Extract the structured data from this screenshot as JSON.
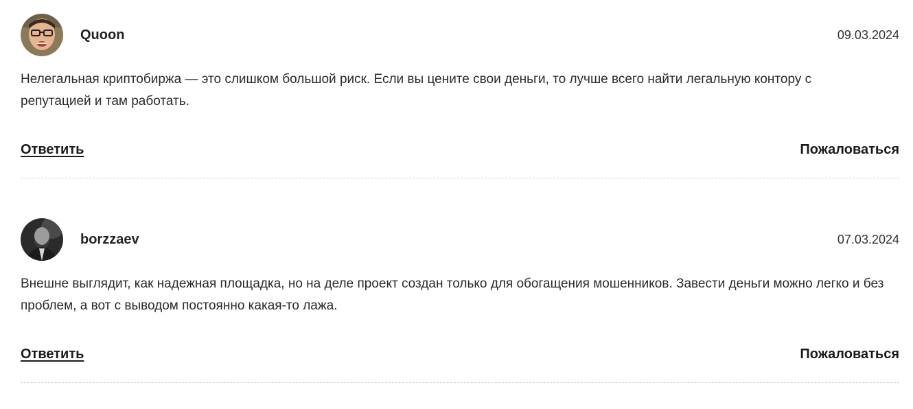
{
  "comments": [
    {
      "author": "Quoon",
      "date": "09.03.2024",
      "text": "Нелегальная криптобиржа — это слишком большой риск. Если вы цените свои деньги, то лучше всего найти легальную контору с репутацией и там работать.",
      "reply_label": "Ответить",
      "report_label": "Пожаловаться"
    },
    {
      "author": "borzzaev",
      "date": "07.03.2024",
      "text": "Внешне выглядит, как надежная площадка, но на деле проект создан только для обогащения мошенников. Завести деньги можно легко и без проблем, а вот с выводом постоянно какая-то лажа.",
      "reply_label": "Ответить",
      "report_label": "Пожаловаться"
    }
  ]
}
